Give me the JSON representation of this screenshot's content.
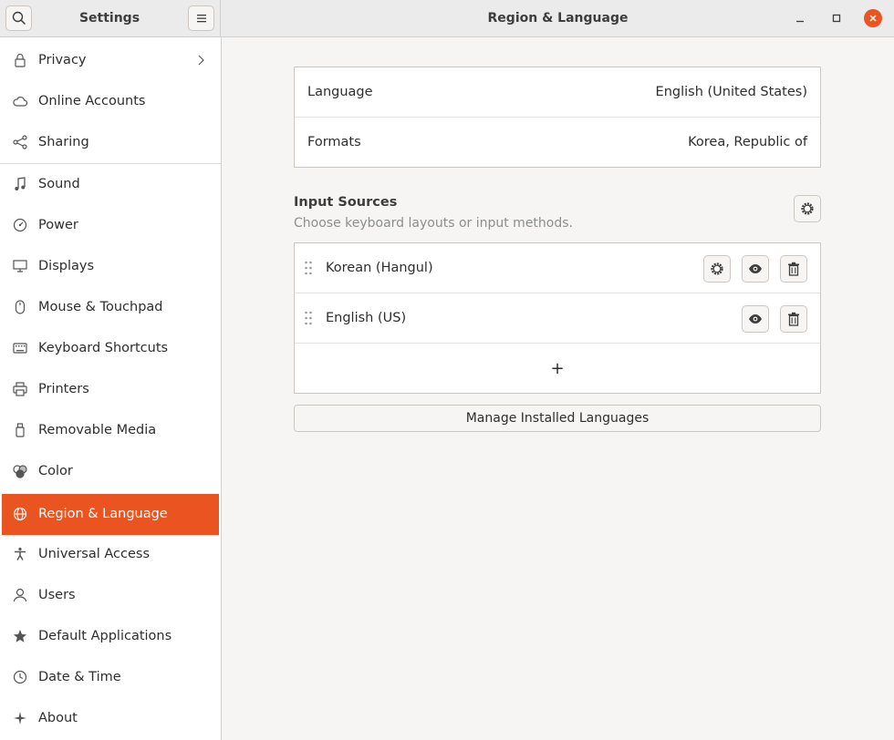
{
  "window": {
    "sidebar_title": "Settings",
    "title": "Region & Language"
  },
  "sidebar": {
    "items": [
      {
        "label": "Privacy",
        "icon": "lock-icon"
      },
      {
        "label": "Online Accounts",
        "icon": "cloud-icon"
      },
      {
        "label": "Sharing",
        "icon": "share-icon"
      },
      {
        "label": "Sound",
        "icon": "music-note-icon"
      },
      {
        "label": "Power",
        "icon": "power-icon"
      },
      {
        "label": "Displays",
        "icon": "display-icon"
      },
      {
        "label": "Mouse & Touchpad",
        "icon": "mouse-icon"
      },
      {
        "label": "Keyboard Shortcuts",
        "icon": "keyboard-icon"
      },
      {
        "label": "Printers",
        "icon": "printer-icon"
      },
      {
        "label": "Removable Media",
        "icon": "usb-icon"
      },
      {
        "label": "Color",
        "icon": "color-icon"
      },
      {
        "label": "Region & Language",
        "icon": "globe-icon",
        "active": true
      },
      {
        "label": "Universal Access",
        "icon": "accessibility-icon"
      },
      {
        "label": "Users",
        "icon": "users-icon"
      },
      {
        "label": "Default Applications",
        "icon": "star-icon"
      },
      {
        "label": "Date & Time",
        "icon": "clock-icon"
      },
      {
        "label": "About",
        "icon": "sparkle-icon"
      }
    ]
  },
  "region": {
    "language_label": "Language",
    "language_value": "English (United States)",
    "formats_label": "Formats",
    "formats_value": "Korea, Republic of"
  },
  "input_sources": {
    "title": "Input Sources",
    "subtitle": "Choose keyboard layouts or input methods.",
    "sources": [
      {
        "label": "Korean (Hangul)",
        "has_settings": true
      },
      {
        "label": "English (US)",
        "has_settings": false
      }
    ],
    "add_symbol": "+"
  },
  "manage_button": "Manage Installed Languages",
  "colors": {
    "accent": "#e95420",
    "sidebar_bg": "#ffffff",
    "content_bg": "#f6f5f4"
  }
}
